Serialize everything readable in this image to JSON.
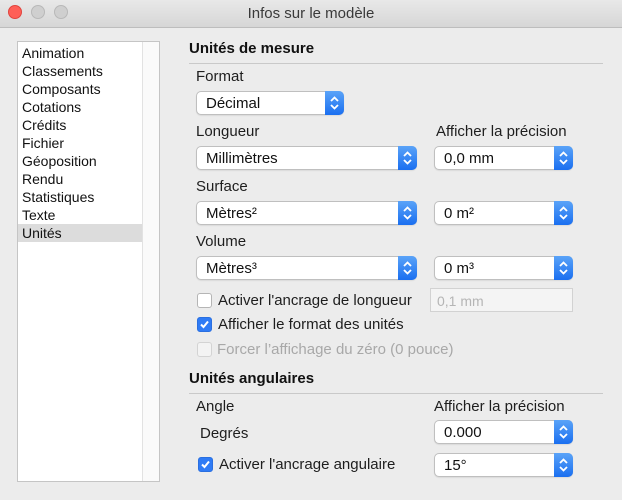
{
  "window": {
    "title": "Infos sur le modèle"
  },
  "sidebar": {
    "items": [
      {
        "label": "Animation"
      },
      {
        "label": "Classements"
      },
      {
        "label": "Composants"
      },
      {
        "label": "Cotations"
      },
      {
        "label": "Crédits"
      },
      {
        "label": "Fichier"
      },
      {
        "label": "Géoposition"
      },
      {
        "label": "Rendu"
      },
      {
        "label": "Statistiques"
      },
      {
        "label": "Texte"
      },
      {
        "label": "Unités"
      }
    ],
    "selected": "Unités"
  },
  "units": {
    "section_title": "Unités de mesure",
    "format_label": "Format",
    "format_value": "Décimal",
    "length_label": "Longueur",
    "length_value": "Millimètres",
    "precision_label": "Afficher la précision",
    "length_precision": "0,0 mm",
    "area_label": "Surface",
    "area_value": "Mètres²",
    "area_precision": "0 m²",
    "volume_label": "Volume",
    "volume_value": "Mètres³",
    "volume_precision": "0 m³",
    "length_snap_label": "Activer l'ancrage de longueur",
    "length_snap_checked": false,
    "length_snap_placeholder": "0,1 mm",
    "show_format_label": "Afficher le format des unités",
    "show_format_checked": true,
    "force_zero_label": "Forcer l’affichage du zéro (0 pouce)",
    "force_zero_checked": false,
    "force_zero_enabled": false
  },
  "angular": {
    "section_title": "Unités angulaires",
    "angle_label": "Angle",
    "precision_label": "Afficher la précision",
    "angle_unit": "Degrés",
    "angle_precision": "0.000",
    "angle_snap_label": "Activer l'ancrage angulaire",
    "angle_snap_checked": true,
    "angle_snap_value": "15°"
  },
  "colors": {
    "accent": "#2f7bf5",
    "close_button": "#ff5f57",
    "selection": "#dcdcdc"
  }
}
